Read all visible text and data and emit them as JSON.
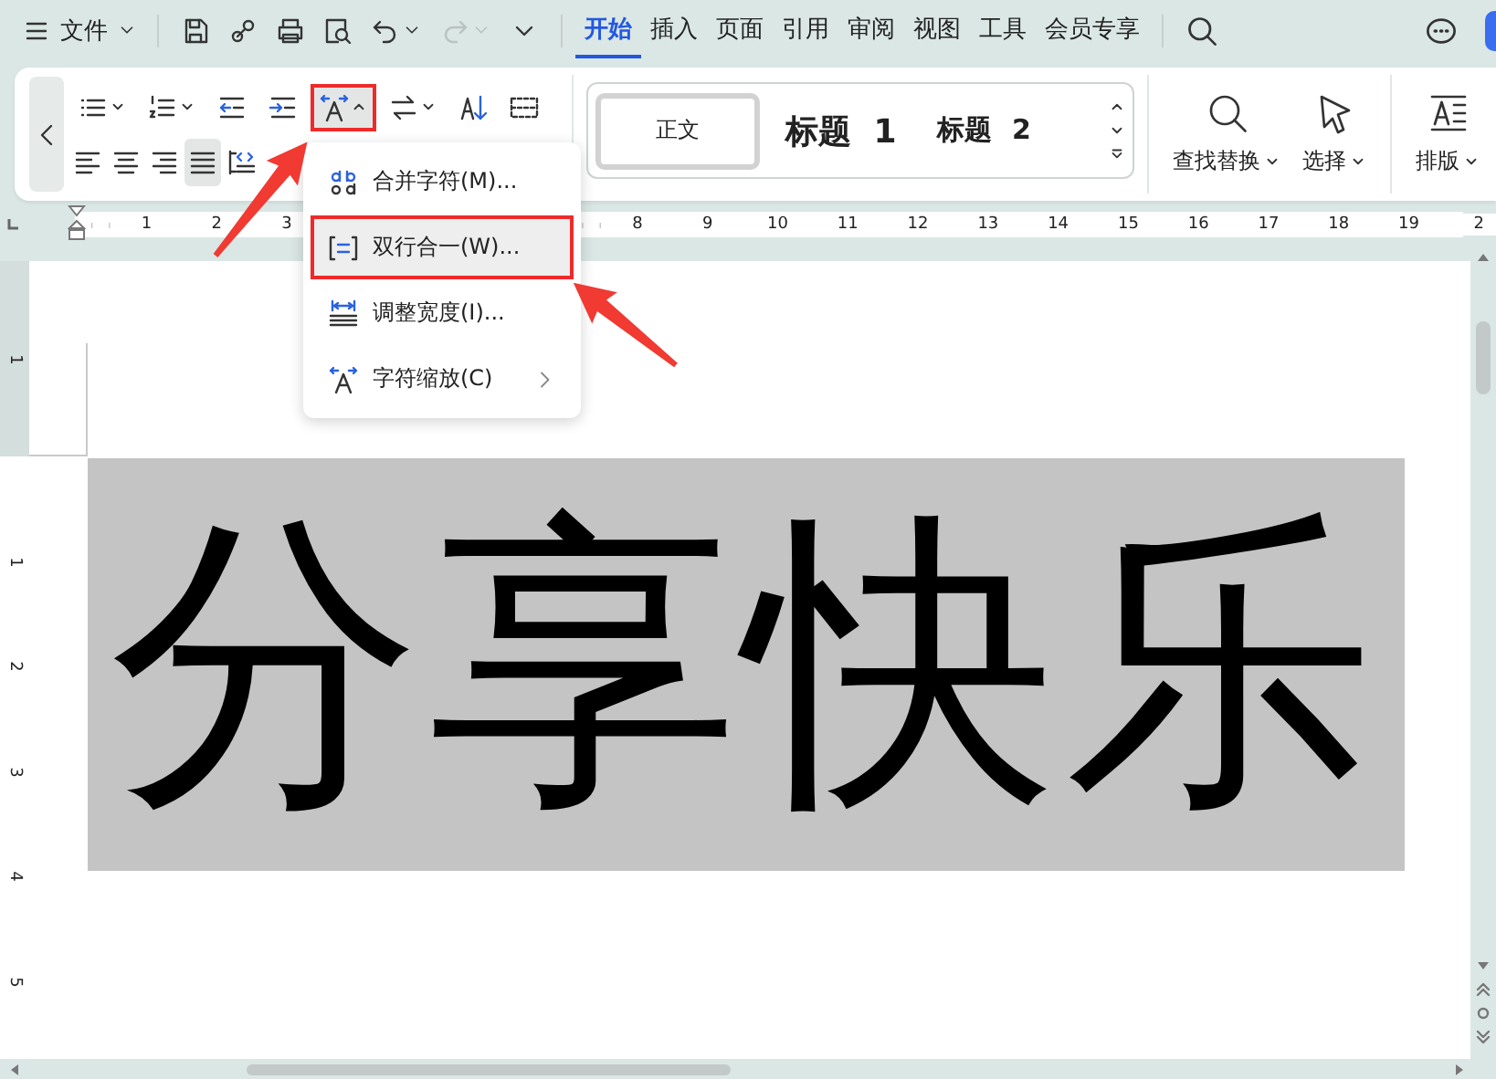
{
  "top_bar": {
    "file_label": "文件",
    "quick_access": [
      {
        "kind": "save",
        "disabled": false
      },
      {
        "kind": "link",
        "disabled": false
      },
      {
        "kind": "print",
        "disabled": false
      },
      {
        "kind": "preview",
        "disabled": false
      },
      {
        "kind": "undo",
        "disabled": false,
        "expanded": false
      },
      {
        "kind": "redo",
        "disabled": true,
        "expanded": false
      },
      {
        "kind": "more",
        "disabled": false
      }
    ],
    "tabs": [
      {
        "label": "开始",
        "selected": true
      },
      {
        "label": "插入",
        "selected": false
      },
      {
        "label": "页面",
        "selected": false
      },
      {
        "label": "引用",
        "selected": false
      },
      {
        "label": "审阅",
        "selected": false
      },
      {
        "label": "视图",
        "selected": false
      },
      {
        "label": "工具",
        "selected": false
      },
      {
        "label": "会员专享",
        "selected": false
      }
    ]
  },
  "ribbon": {
    "rows": [
      [
        {
          "kind": "bullets",
          "selected": false,
          "annotated": false,
          "expanded": false
        },
        {
          "kind": "numbering",
          "selected": false,
          "annotated": false,
          "expanded": false
        },
        {
          "kind": "outdent",
          "selected": false,
          "annotated": false
        },
        {
          "kind": "indent",
          "selected": false,
          "annotated": false
        },
        {
          "kind": "char-scale",
          "selected": true,
          "annotated": true,
          "expanded": true
        },
        {
          "kind": "text-direction",
          "selected": false,
          "annotated": false,
          "expanded": false
        },
        {
          "kind": "sort",
          "selected": false,
          "annotated": false
        },
        {
          "kind": "table-border",
          "selected": false,
          "annotated": false
        }
      ],
      [
        {
          "kind": "align-left",
          "selected": false,
          "annotated": false
        },
        {
          "kind": "align-center",
          "selected": false,
          "annotated": false
        },
        {
          "kind": "align-right",
          "selected": false,
          "annotated": false
        },
        {
          "kind": "justify",
          "selected": true,
          "annotated": false
        },
        {
          "kind": "distribute",
          "selected": false,
          "annotated": false
        }
      ]
    ],
    "styles": [
      {
        "label": "正文",
        "selected": true
      },
      {
        "label": "标题 1",
        "selected": false
      },
      {
        "label": "标题 2",
        "selected": false
      }
    ],
    "tools": [
      {
        "kind": "find",
        "label": "查找替换"
      },
      {
        "kind": "select",
        "label": "选择"
      },
      {
        "kind": "layout",
        "label": "排版"
      }
    ]
  },
  "ruler": {
    "left_labels": [
      "1",
      "2",
      "3"
    ],
    "right_labels": [
      "8",
      "9",
      "10",
      "11",
      "12",
      "13",
      "14",
      "15",
      "16",
      "17",
      "18",
      "19",
      "2"
    ],
    "vertical_top_label": "1",
    "vertical_labels": [
      "1",
      "2",
      "3",
      "4",
      "5"
    ]
  },
  "document": {
    "text": "分享快乐",
    "highlighted": true
  },
  "dropdown": {
    "items": [
      {
        "kind": "combine",
        "label": "合并字符(M)...",
        "selected": false,
        "annotated": false,
        "submenu": false
      },
      {
        "kind": "two-lines",
        "label": "双行合一(W)...",
        "selected": true,
        "annotated": true,
        "submenu": false
      },
      {
        "kind": "adjust-width",
        "label": "调整宽度(I)...",
        "selected": false,
        "annotated": false,
        "submenu": false
      },
      {
        "kind": "char-scale",
        "label": "字符缩放(C)",
        "selected": false,
        "annotated": false,
        "submenu": true
      }
    ]
  }
}
